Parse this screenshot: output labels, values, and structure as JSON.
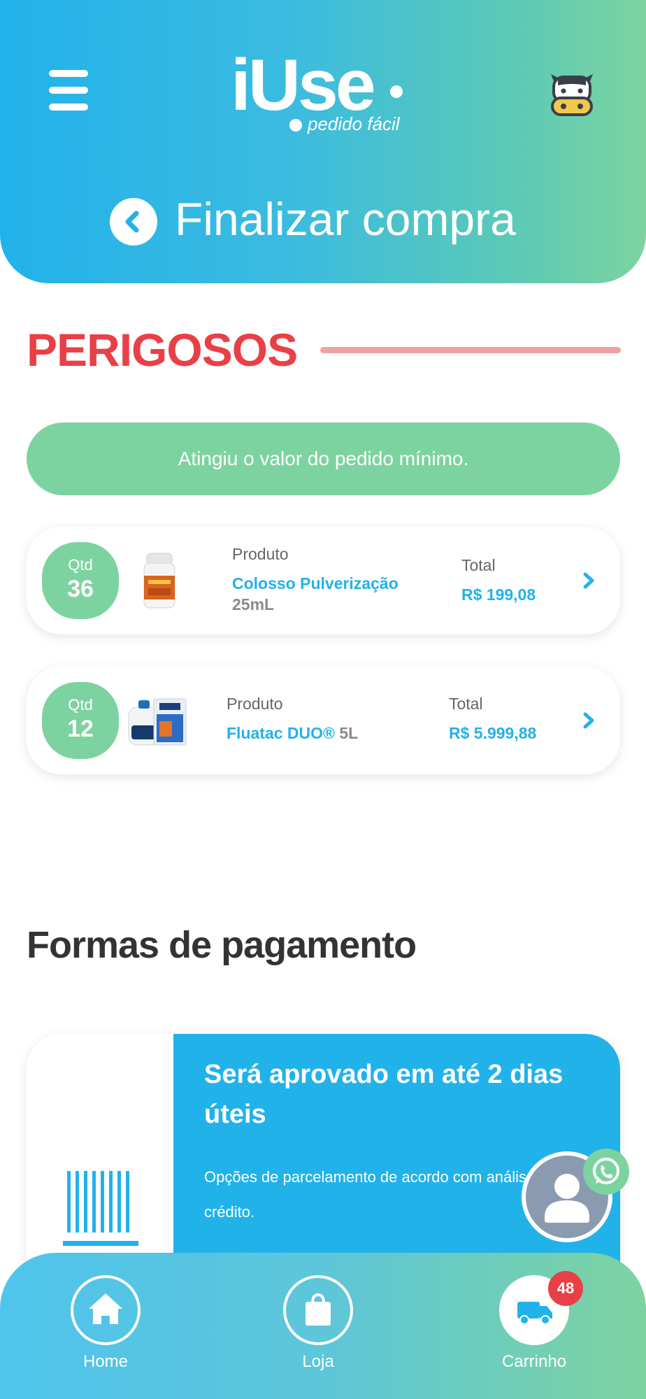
{
  "header": {
    "logo_main": "iUse",
    "logo_sub": "pedido fácil",
    "title": "Finalizar compra"
  },
  "section": {
    "title": "PERIGOSOS",
    "notice": "Atingiu o valor do pedido mínimo."
  },
  "products": [
    {
      "qty_label": "Qtd",
      "qty": "36",
      "product_label": "Produto",
      "name": "Colosso Pulverização",
      "size": "25mL",
      "total_label": "Total",
      "total": "R$ 199,08"
    },
    {
      "qty_label": "Qtd",
      "qty": "12",
      "product_label": "Produto",
      "name": "Fluatac DUO®",
      "size": "5L",
      "total_label": "Total",
      "total": "R$ 5.999,88"
    }
  ],
  "payment": {
    "title": "Formas de pagamento",
    "option_title": "Será aprovado em até 2 dias úteis",
    "option_desc": "Opções de parcelamento de acordo com análise de crédito."
  },
  "nav": {
    "home": "Home",
    "shop": "Loja",
    "cart": "Carrinho",
    "cart_count": "48"
  },
  "colors": {
    "blue": "#22b2ea",
    "green": "#7dd3a0",
    "red": "#e84046"
  },
  "icons": [
    "menu-icon",
    "cow-icon",
    "back-arrow-icon",
    "chevron-right-icon",
    "barcode-icon",
    "user-icon",
    "whatsapp-icon",
    "home-icon",
    "shopping-bag-icon",
    "truck-icon"
  ]
}
